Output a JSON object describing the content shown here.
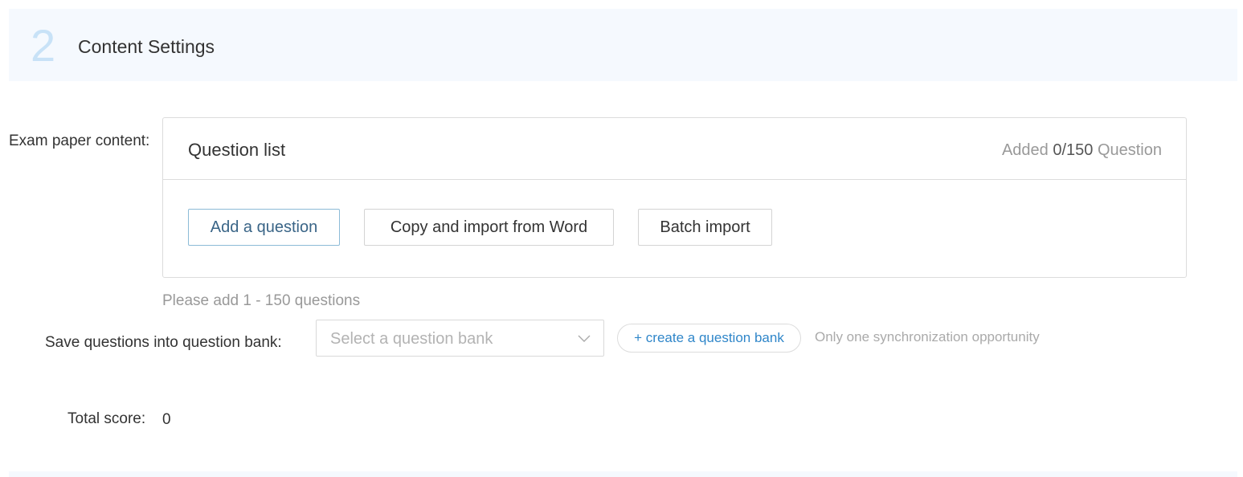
{
  "section": {
    "step_number": "2",
    "title": "Content Settings"
  },
  "form": {
    "exam_paper_label": "Exam paper content:",
    "bank_label": "Save questions into question bank:",
    "score_label": "Total score:",
    "score_value": "0"
  },
  "question_list": {
    "title": "Question list",
    "count_prefix": "Added ",
    "count_current": "0",
    "count_separator": "/",
    "count_max": "150",
    "count_suffix": " Question",
    "buttons": {
      "add": "Add a question",
      "copy_word": "Copy and import from Word",
      "batch": "Batch import"
    }
  },
  "hint": "Please add 1 - 150 questions",
  "bank": {
    "select_placeholder": "Select a question bank",
    "create_label": "+ create a question bank",
    "sync_note": "Only one synchronization opportunity"
  },
  "colors": {
    "accent": "#2f86c9",
    "header_bg": "#f5f9fe",
    "step_number": "#c8e2f7",
    "primary_btn_border": "#8cbbd7"
  }
}
